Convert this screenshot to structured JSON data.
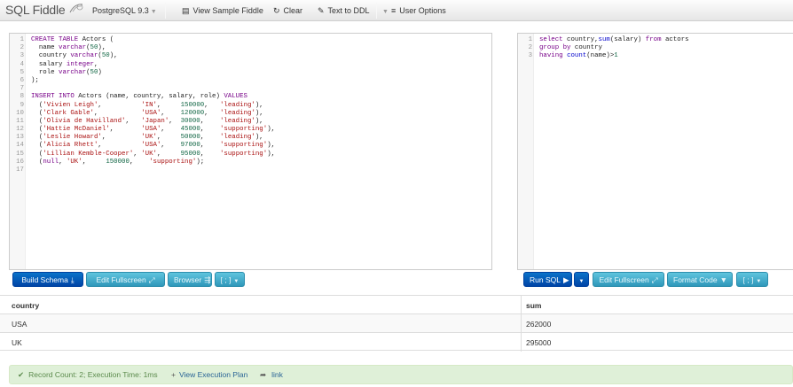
{
  "navbar": {
    "brand": "SQL Fiddle",
    "db_version": "PostgreSQL 9.3",
    "view_sample": "View Sample Fiddle",
    "clear": "Clear",
    "text_to_ddl": "Text to DDL",
    "user_options": "User Options"
  },
  "schema_editor": {
    "line_numbers": [
      "1",
      "2",
      "3",
      "4",
      "5",
      "6",
      "7",
      "8",
      "9",
      "10",
      "11",
      "12",
      "13",
      "14",
      "15",
      "16",
      "17"
    ]
  },
  "query_editor": {
    "line_numbers": [
      "1",
      "2",
      "3"
    ]
  },
  "buttons": {
    "build_schema": "Build Schema",
    "edit_fullscreen_left": "Edit Fullscreen",
    "browser": "Browser",
    "options_left": "[ ; ]",
    "run_sql": "Run SQL",
    "edit_fullscreen_right": "Edit Fullscreen",
    "format_code": "Format Code",
    "options_right": "[ ; ]"
  },
  "results": {
    "columns": [
      "country",
      "sum"
    ],
    "rows": [
      [
        "USA",
        "262000"
      ],
      [
        "UK",
        "295000"
      ]
    ]
  },
  "status": {
    "summary": "Record Count: 2; Execution Time: 1ms",
    "view_plan": "View Execution Plan",
    "link": "link"
  },
  "colors": {
    "primary": "#0055b3",
    "info": "#49afcd",
    "success_bg": "#dff0d8"
  }
}
